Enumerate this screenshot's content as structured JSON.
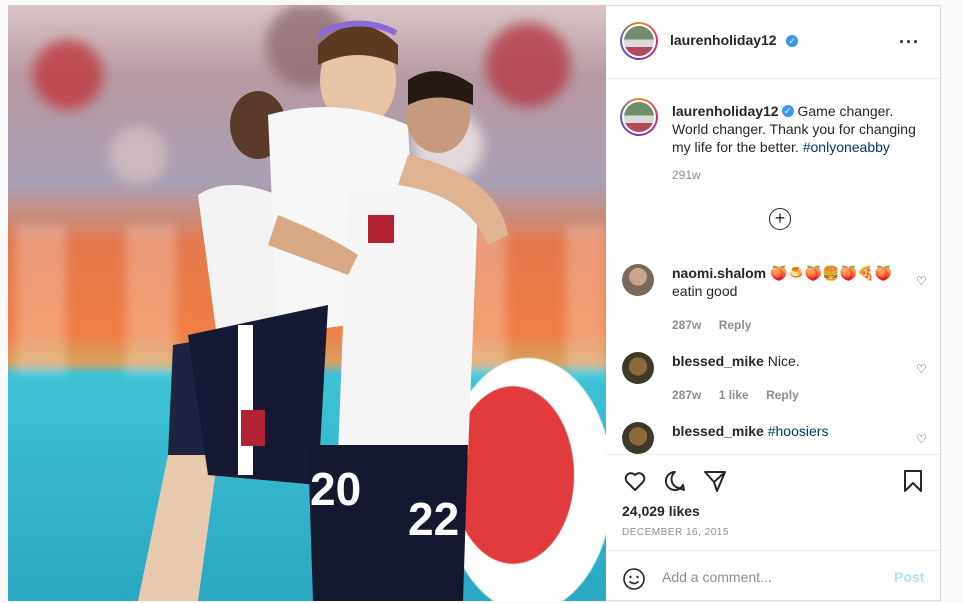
{
  "post": {
    "username": "laurenholiday12",
    "caption": "Game changer. World changer. Thank you for changing my life for the better.",
    "hashtag": "#onlyoneabby",
    "caption_time": "291w",
    "likes": "24,029 likes",
    "date": "DECEMBER 16, 2015",
    "jersey_numbers": [
      "20",
      "22"
    ]
  },
  "comments": [
    {
      "username": "naomi.shalom",
      "emoji": "🍑🍮🍑🍔🍑🍕🍑",
      "text": "eatin good",
      "time": "287w",
      "likes": "",
      "reply": "Reply"
    },
    {
      "username": "blessed_mike",
      "text": "Nice.",
      "time": "287w",
      "likes": "1 like",
      "reply": "Reply"
    },
    {
      "username": "blessed_mike",
      "text": "#hoosiers"
    }
  ],
  "add_comment": {
    "placeholder": "Add a comment...",
    "post_label": "Post"
  },
  "icons": [
    "more-icon",
    "verified-icon",
    "load-more-icon",
    "heart-icon",
    "comment-icon",
    "share-icon",
    "bookmark-icon",
    "emoji-icon"
  ],
  "colors": {
    "link": "#00376b",
    "verified": "#3897f0",
    "post_disabled": "#b2dffc",
    "muted": "#8e8e8e"
  }
}
